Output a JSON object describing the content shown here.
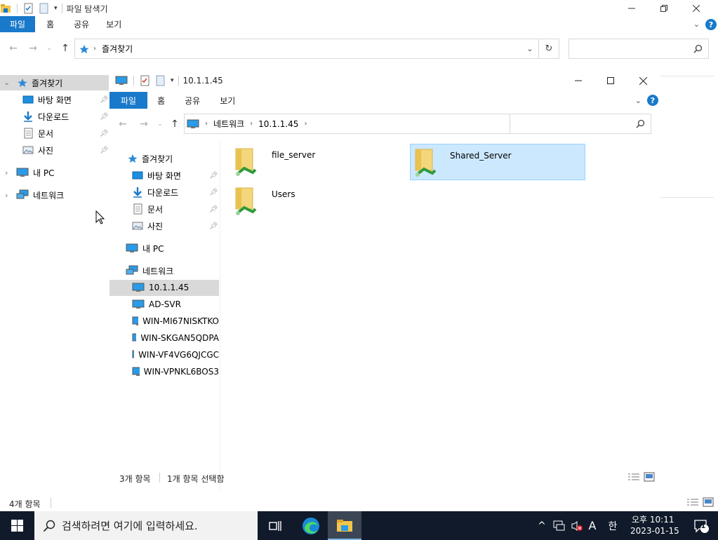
{
  "back_window": {
    "title": "파일 탐색기",
    "ribbon_tabs": [
      "파일",
      "홈",
      "공유",
      "보기"
    ],
    "address_path": "즐겨찾기",
    "search_placeholder": "",
    "status": "4개 항목",
    "nav": {
      "favorites": "즐겨찾기",
      "favorites_items": [
        "바탕 화면",
        "다운로드",
        "문서",
        "사진"
      ],
      "this_pc": "내 PC",
      "network": "네트워크"
    }
  },
  "front_window": {
    "title": "10.1.1.45",
    "ribbon_tabs": [
      "파일",
      "홈",
      "공유",
      "보기"
    ],
    "breadcrumb": [
      "네트워크",
      "10.1.1.45"
    ],
    "search_placeholder": "",
    "nav": {
      "favorites": "즐겨찾기",
      "favorites_items": [
        "바탕 화면",
        "다운로드",
        "문서",
        "사진"
      ],
      "this_pc": "내 PC",
      "network": "네트워크",
      "network_items": [
        "10.1.1.45",
        "AD-SVR",
        "WIN-MI67NISKTKO",
        "WIN-SKGAN5QDPA",
        "WIN-VF4VG6QJCGC",
        "WIN-VPNKL6BOS3"
      ]
    },
    "files": [
      {
        "name": "file_server",
        "selected": false
      },
      {
        "name": "Shared_Server",
        "selected": true
      },
      {
        "name": "Users",
        "selected": false
      }
    ],
    "status_count": "3개 항목",
    "status_selected": "1개 항목 선택함"
  },
  "taskbar": {
    "search_placeholder": "검색하려면 여기에 입력하세요.",
    "ime_mode": "A",
    "ime_lang": "한",
    "time": "오후 10:11",
    "date": "2023-01-15",
    "notification_count": "1"
  },
  "colors": {
    "accent": "#1979ca",
    "selection": "#cce8ff",
    "selection_border": "#99d1ff",
    "nav_selected": "#d9d9d9",
    "taskbar": "#101a2a"
  }
}
